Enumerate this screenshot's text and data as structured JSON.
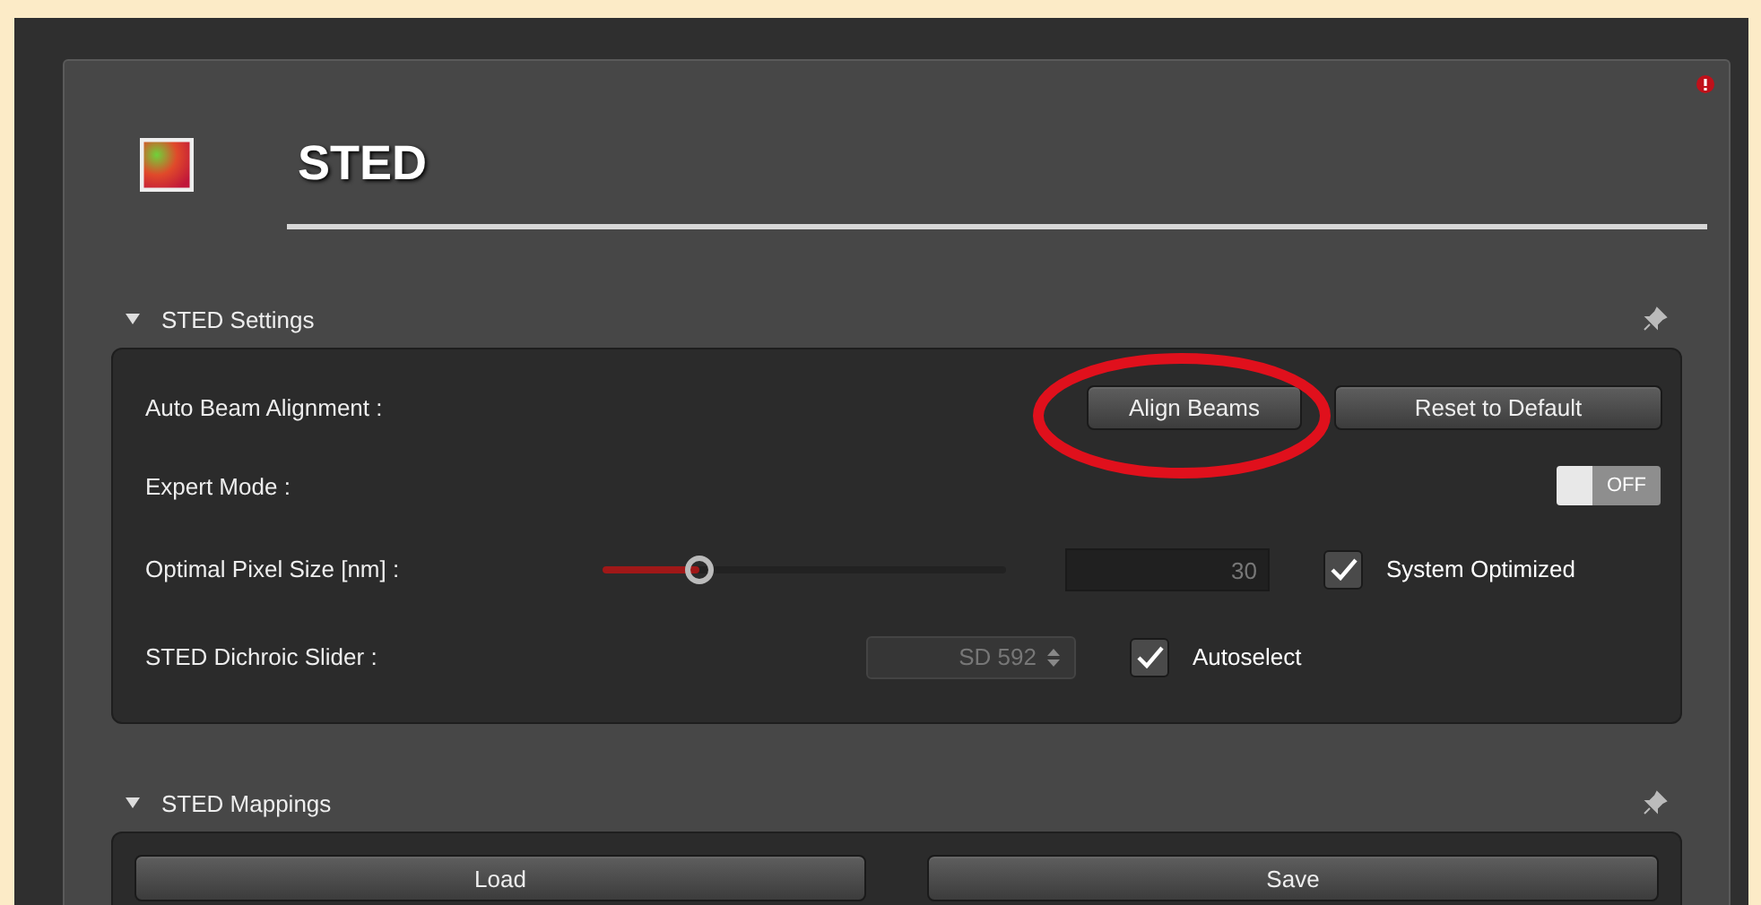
{
  "title": "STED",
  "sections": [
    {
      "title": "STED Settings",
      "expanded": true,
      "rows": [
        {
          "kind": "buttons",
          "label": "Auto Beam Alignment :",
          "buttons": [
            "Align Beams",
            "Reset to Default"
          ]
        },
        {
          "kind": "toggle",
          "label": "Expert Mode :",
          "on": false,
          "state_text": "OFF"
        },
        {
          "kind": "slider",
          "label": "Optimal Pixel Size [nm] :",
          "level": 0.24,
          "value": "30",
          "checkbox": {
            "label": "System Optimized",
            "checked": true
          }
        },
        {
          "kind": "dropdown",
          "label": "STED Dichroic Slider :",
          "value": "SD 592",
          "checkbox": {
            "label": "Autoselect",
            "checked": true
          }
        }
      ]
    },
    {
      "title": "STED Mappings",
      "expanded": true,
      "buttons": [
        "Load",
        "Save"
      ]
    }
  ]
}
